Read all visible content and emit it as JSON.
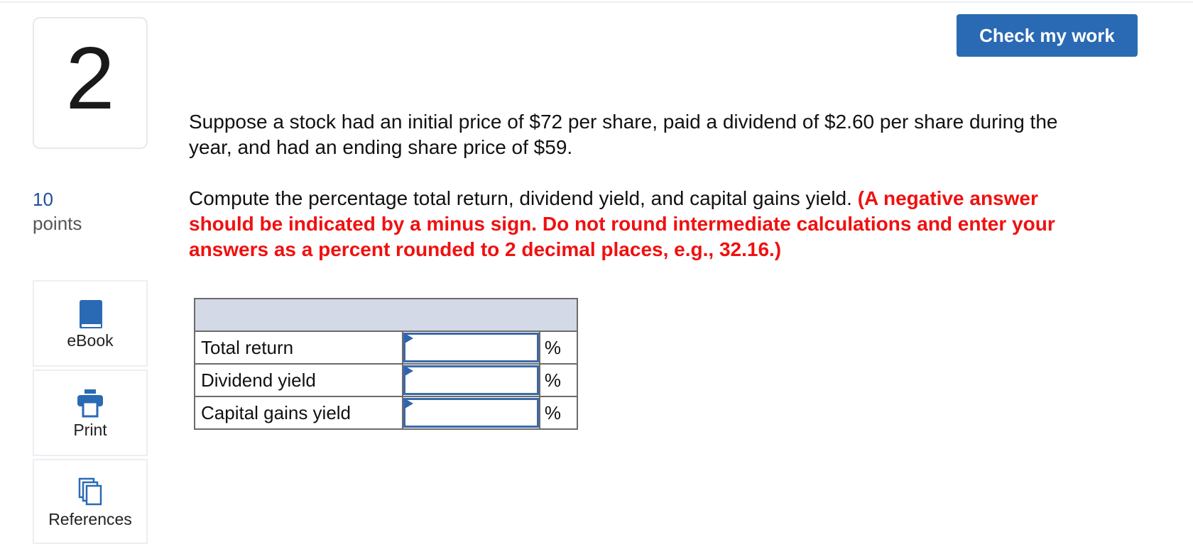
{
  "question": {
    "number": "2",
    "points_value": "10",
    "points_label": "points"
  },
  "tools": {
    "ebook_label": "eBook",
    "print_label": "Print",
    "references_label": "References"
  },
  "check_button": "Check my work",
  "prompt": {
    "para1": "Suppose a stock had an initial price of $72 per share, paid a dividend of $2.60 per share during the year, and had an ending share price of $59.",
    "para2_plain": "Compute the percentage total return, dividend yield, and capital gains yield. ",
    "para2_instruction": "(A negative answer should be indicated by a minus sign. Do not round intermediate calculations and enter your answers as a percent rounded to 2 decimal places, e.g., 32.16.)"
  },
  "answer_table": {
    "header": "",
    "rows": [
      {
        "label": "Total return",
        "value": "",
        "unit": "%"
      },
      {
        "label": "Dividend yield",
        "value": "",
        "unit": "%"
      },
      {
        "label": "Capital gains yield",
        "value": "",
        "unit": "%"
      }
    ]
  },
  "colors": {
    "accent": "#2a6ab4",
    "instruction": "#f01010",
    "table_header": "#d3d9e6",
    "points_number": "#1d4f9c"
  }
}
